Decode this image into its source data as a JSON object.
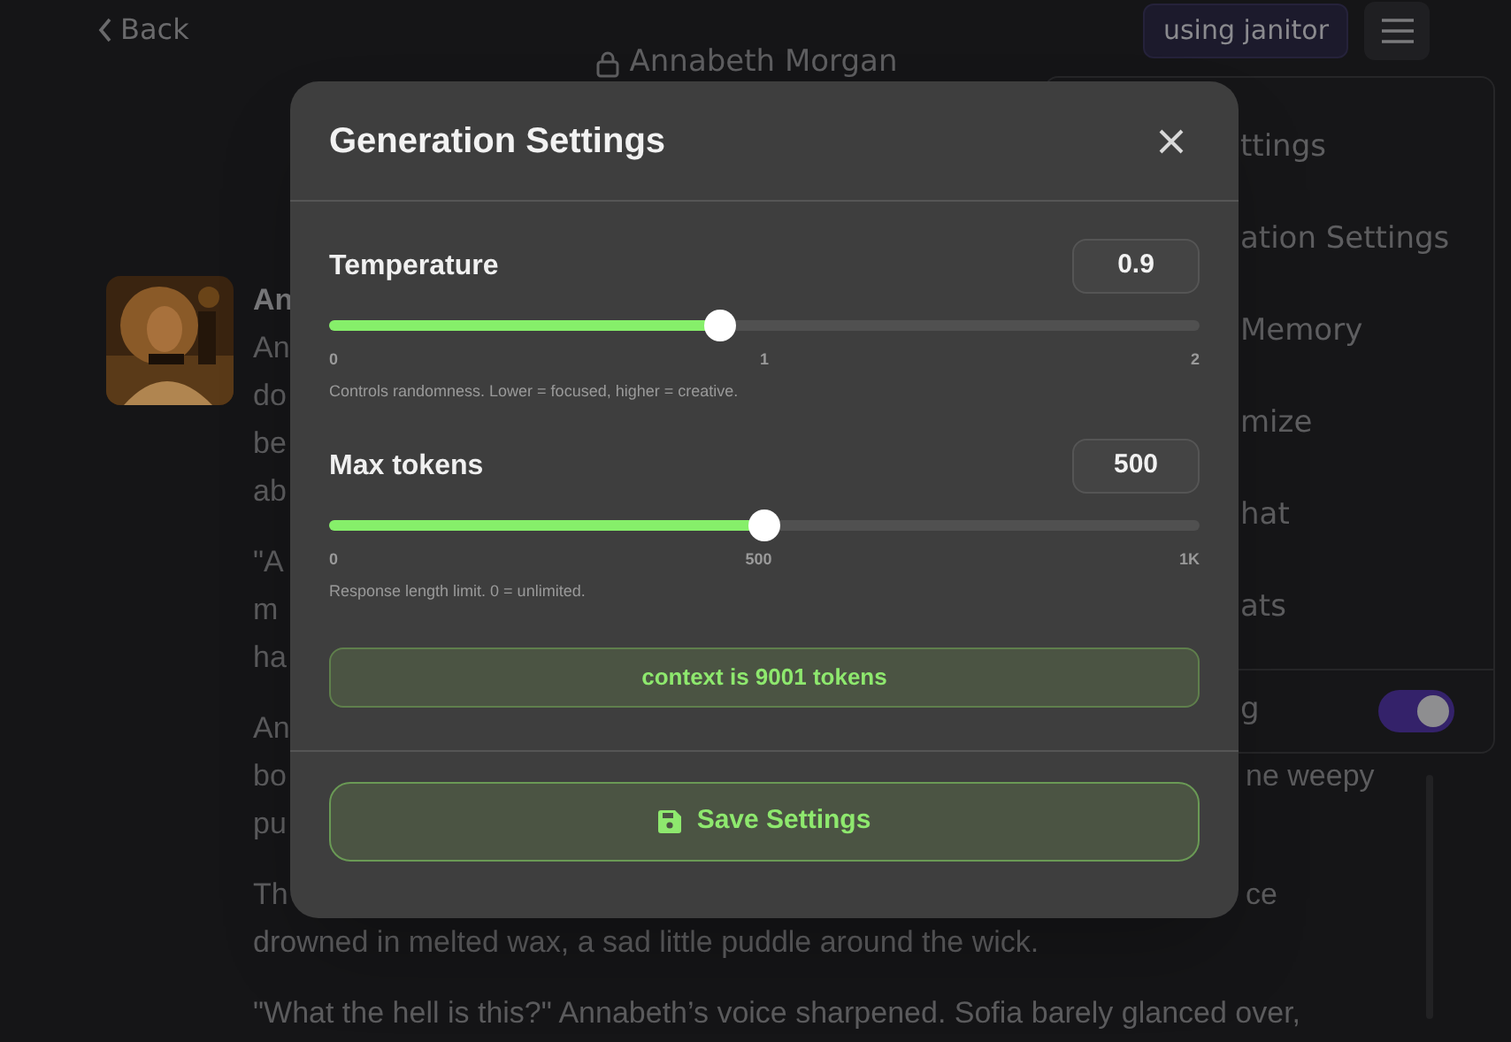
{
  "header": {
    "back": "Back",
    "title": "Annabeth Morgan",
    "badge": "using janitor"
  },
  "chat": {
    "author": "An",
    "paragraphs": [
      {
        "lines": [
          {
            "left": "An"
          },
          {
            "left": "do"
          },
          {
            "left": "be"
          },
          {
            "left": "ab"
          }
        ]
      },
      {
        "lines": [
          {
            "left": "\"A"
          },
          {
            "left": "m"
          },
          {
            "left": "ha"
          }
        ]
      },
      {
        "lines": [
          {
            "left": "An"
          },
          {
            "left": "bo",
            "right": "ne weepy"
          },
          {
            "left": "pu"
          }
        ]
      },
      {
        "lines": [
          {
            "left": "Th",
            "right": "ce"
          },
          {
            "left": "drowned in melted wax, a sad little puddle around the wick."
          }
        ]
      },
      {
        "lines": [
          {
            "left": "\"What the hell is this?\" Annabeth’s voice sharpened. Sofia barely glanced over,"
          }
        ]
      }
    ]
  },
  "menu": {
    "items": [
      "ttings",
      "ation Settings",
      "Memory",
      "mize",
      "hat",
      "ats"
    ],
    "toggle": {
      "label": "g",
      "on": true
    }
  },
  "modal": {
    "title": "Generation Settings",
    "sliders": [
      {
        "label": "Temperature",
        "value": "0.9",
        "level": 0.45,
        "ticks": [
          "0",
          "1",
          "2"
        ],
        "help": "Controls randomness. Lower = focused, higher = creative."
      },
      {
        "label": "Max tokens",
        "value": "500",
        "level": 0.5,
        "ticks": [
          "0",
          "500",
          "1K"
        ],
        "help": "Response length limit. 0 = unlimited."
      }
    ],
    "context": "context is 9001 tokens",
    "save": "Save Settings"
  }
}
